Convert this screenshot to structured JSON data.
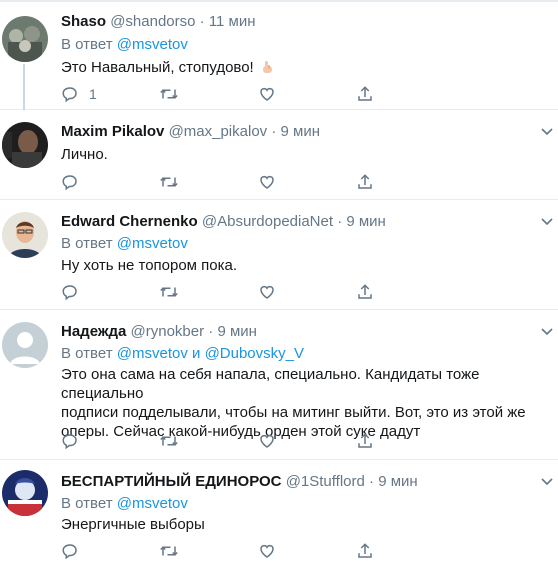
{
  "tweets": [
    {
      "name": "Shaso",
      "handle": "@shandorso",
      "dot": "·",
      "time": "11 мин",
      "reply_prefix": "В ответ",
      "reply_to": [
        "@msvetov"
      ],
      "reply_joiner": "",
      "text": "Это Навальный, стопудово!",
      "emoji": "hand-emoji",
      "reply_count": "1"
    },
    {
      "name": "Maxim Pikalov",
      "handle": "@max_pikalov",
      "dot": "·",
      "time": "9 мин",
      "text": "Лично."
    },
    {
      "name": "Edward Chernenko",
      "handle": "@AbsurdopediaNet",
      "dot": "·",
      "time": "9 мин",
      "reply_prefix": "В ответ",
      "reply_to": [
        "@msvetov"
      ],
      "text": "Ну хоть не топором пока."
    },
    {
      "name": "Надежда",
      "handle": "@rynokber",
      "dot": "·",
      "time": "9 мин",
      "reply_prefix": "В ответ",
      "reply_to": [
        "@msvetov",
        "@Dubovsky_V"
      ],
      "reply_joiner": "и",
      "text_lines": [
        "Это она сама на себя напала, специально. Кандидаты тоже специально",
        "подписи подделывали, чтобы на митинг выйти. Вот, это из этой же",
        "оперы. Сейчас какой-нибудь орден этой суке дадут"
      ]
    },
    {
      "name": "БЕСПАРТИЙНЫЙ ЕДИНОРОС",
      "handle": "@1Stufflord",
      "dot": "·",
      "time": "9 мин",
      "reply_prefix": "В ответ",
      "reply_to": [
        "@msvetov"
      ],
      "text": "Энергичные выборы"
    }
  ],
  "icons": {
    "reply": "reply-icon",
    "retweet": "retweet-icon",
    "like": "like-icon",
    "share": "share-icon",
    "more": "caret-down-icon"
  },
  "colors": {
    "link": "#1b95e0",
    "secondary_text": "#657786",
    "divider": "#e6ecf0"
  }
}
